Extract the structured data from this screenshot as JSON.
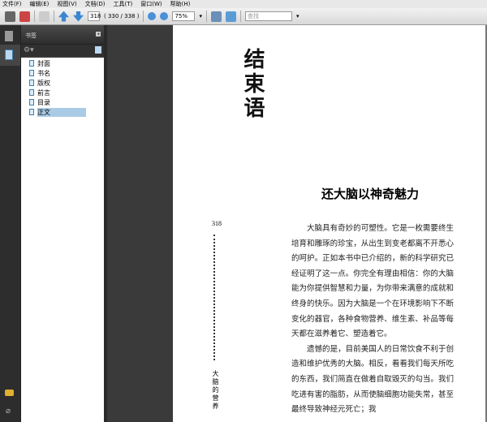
{
  "menu": [
    "文件(F)",
    "编辑(E)",
    "视图(V)",
    "文档(D)",
    "工具(T)",
    "窗口(W)",
    "帮助(H)"
  ],
  "toolbar": {
    "page_input": "318",
    "page_count": "( 330 / 338 )",
    "zoom": "75%",
    "search_placeholder": "查找"
  },
  "panel": {
    "title": "书签",
    "bookmarks": [
      "封面",
      "书名",
      "版权",
      "前言",
      "目录",
      "正文"
    ],
    "selected": 5
  },
  "page": {
    "part_title": "结束语",
    "heading": "还大脑以神奇魅力",
    "page_number": "318",
    "running_head": "大脑的营养",
    "paragraphs": [
      "大脑具有奇妙的可塑性。它是一枚需要终生培育和雕琢的珍宝，从出生到变老都离不开悉心的呵护。正如本书中已介绍的，新的科学研究已经证明了这一点。你完全有理由相信：你的大脑能为你提供智慧和力量，为你带来满意的成就和终身的快乐。因为大脑是一个在环境影响下不断变化的器官，各种食物营养、维生素、补品等每天都在滋养着它、塑造着它。",
      "遗憾的是，目前美国人的日常饮食不利于创造和维护优秀的大脑。相反，看看我们每天所吃的东西，我们简直在做着自取毁灭的勾当。我们吃进有害的脂肪，从而使脑细胞功能失常，甚至最终导致神经元死亡；我"
    ]
  }
}
